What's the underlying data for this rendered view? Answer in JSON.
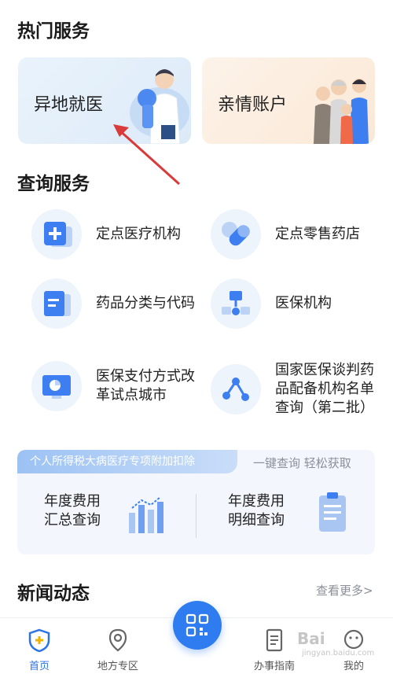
{
  "hot_services": {
    "title": "热门服务",
    "cards": [
      {
        "label": "异地就医"
      },
      {
        "label": "亲情账户"
      }
    ]
  },
  "query_services": {
    "title": "查询服务",
    "items": [
      {
        "label": "定点医疗机构",
        "icon": "medical-cross-icon"
      },
      {
        "label": "定点零售药店",
        "icon": "pill-icon"
      },
      {
        "label": "药品分类与代码",
        "icon": "document-icon"
      },
      {
        "label": "医保机构",
        "icon": "org-chart-icon"
      },
      {
        "label": "医保支付方式改革试点城市",
        "icon": "monitor-chart-icon"
      },
      {
        "label": "国家医保谈判药品配备机构名单查询（第二批）",
        "icon": "network-icon"
      }
    ]
  },
  "tax": {
    "banner": "个人所得税大病医疗专项附加扣除",
    "slogan": "一键查询 轻松获取",
    "summary_line1": "年度费用",
    "summary_line2": "汇总查询",
    "detail_line1": "年度费用",
    "detail_line2": "明细查询"
  },
  "news": {
    "title": "新闻动态",
    "more": "查看更多>"
  },
  "tabbar": {
    "items": [
      {
        "label": "首页",
        "icon": "home-shield-icon",
        "active": true
      },
      {
        "label": "地方专区",
        "icon": "location-pin-icon",
        "active": false
      },
      {
        "label": "办事指南",
        "icon": "guide-document-icon",
        "active": false
      },
      {
        "label": "我的",
        "icon": "profile-icon",
        "active": false
      }
    ],
    "center_icon": "qr-scan-icon"
  },
  "watermark": {
    "text": "Bai",
    "sub": "jingyan.baidu.com"
  },
  "colors": {
    "accent": "#2f7cf0",
    "icon_blue": "#3d7ef0",
    "annotation_arrow": "#d93a3a"
  }
}
